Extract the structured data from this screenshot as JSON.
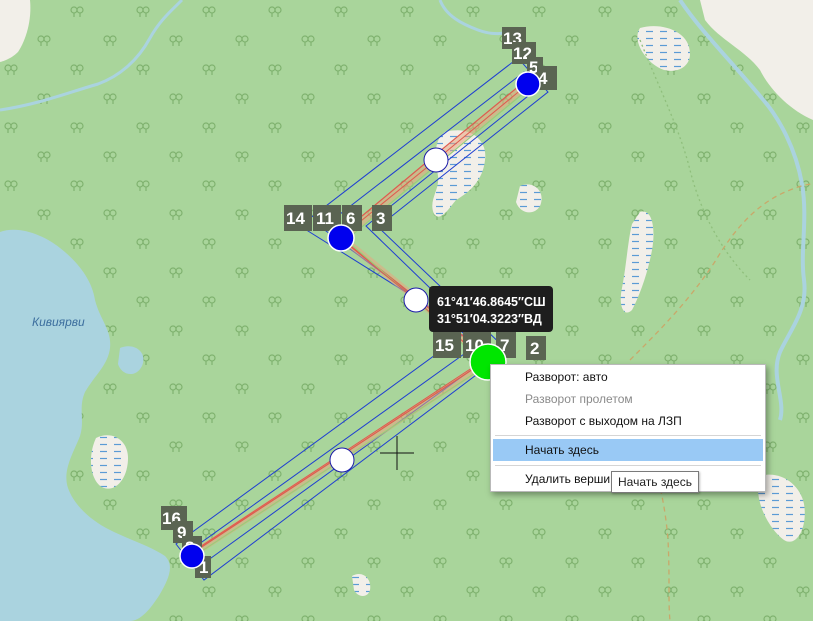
{
  "map": {
    "lake_label": "Кивиярви",
    "colors": {
      "forest": "#a9d59b",
      "water": "#aad3df",
      "swamp_fill": "#f2efe9",
      "swamp_mark": "#5b9bd5",
      "river": "#aad3df",
      "corridor": "#1f3fd1",
      "flight_line_red": "#e05a4e",
      "flight_line_green": "#9acd7a",
      "vertex_blue": "#0000ee",
      "vertex_start": "#00e600",
      "label_bg": "#5a6452"
    },
    "vertex_labels": [
      "13",
      "12",
      "5",
      "4",
      "14",
      "11",
      "6",
      "3",
      "15",
      "10",
      "7",
      "2",
      "16",
      "9",
      "8",
      "1"
    ]
  },
  "coord_tooltip": {
    "lat": "61°41′46.8645″СШ",
    "lon": "31°51′04.3223″ВД"
  },
  "context_menu": {
    "items": [
      {
        "label": "Разворот: авто",
        "enabled": true
      },
      {
        "label": "Разворот пролетом",
        "enabled": false
      },
      {
        "label": "Разворот с выходом на ЛЗП",
        "enabled": true
      },
      {
        "label": "Начать здесь",
        "enabled": true,
        "highlighted": true
      },
      {
        "label": "Удалить верши",
        "enabled": true
      }
    ]
  },
  "hint_tooltip": {
    "text": "Начать здесь"
  }
}
